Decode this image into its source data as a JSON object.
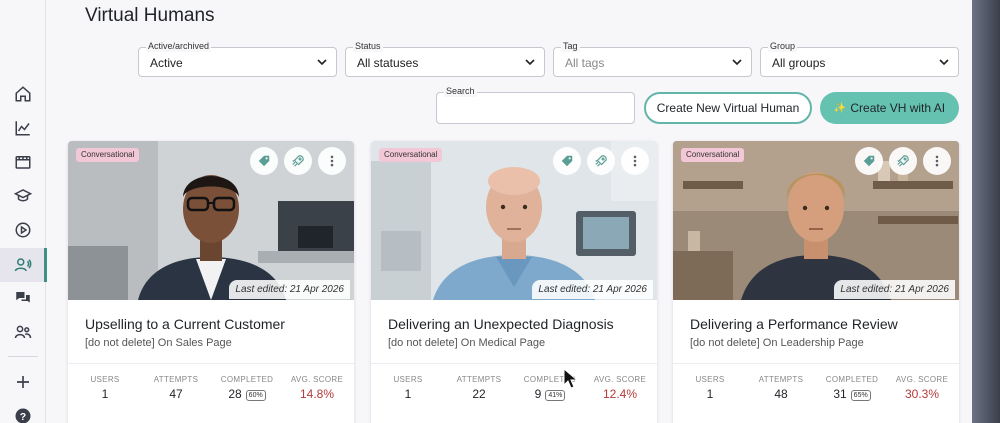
{
  "page": {
    "title": "Virtual Humans"
  },
  "filters": {
    "active": {
      "label": "Active/archived",
      "value": "Active"
    },
    "status": {
      "label": "Status",
      "value": "All statuses"
    },
    "tag": {
      "label": "Tag",
      "placeholder": "All tags"
    },
    "group": {
      "label": "Group",
      "value": "All groups"
    }
  },
  "search": {
    "label": "Search"
  },
  "actions": {
    "create_new": "Create New Virtual Human",
    "create_ai": "Create VH with AI",
    "create_ai_icon": "✨"
  },
  "stat_labels": {
    "users": "USERS",
    "attempts": "ATTEMPTS",
    "completed": "COMPLETED",
    "avg_score": "AVG. SCORE"
  },
  "cards": [
    {
      "badge": "Conversational",
      "edited": "Last edited:  21 Apr 2026",
      "title": "Upselling to a Current Customer",
      "subtitle": "[do not delete] On Sales Page",
      "users": "1",
      "attempts": "47",
      "completed": "28",
      "completed_pct": "60%",
      "avg_score": "14.8%"
    },
    {
      "badge": "Conversational",
      "edited": "Last edited:  21 Apr 2026",
      "title": "Delivering an Unexpected Diagnosis",
      "subtitle": "[do not delete] On Medical Page",
      "users": "1",
      "attempts": "22",
      "completed": "9",
      "completed_pct": "41%",
      "avg_score": "12.4%"
    },
    {
      "badge": "Conversational",
      "edited": "Last edited:  21 Apr 2026",
      "title": "Delivering a Performance Review",
      "subtitle": "[do not delete] On Leadership Page",
      "users": "1",
      "attempts": "48",
      "completed": "31",
      "completed_pct": "65%",
      "avg_score": "30.3%"
    }
  ],
  "colors": {
    "accent": "#62b6a8",
    "badge": "#f2c7d6",
    "score": "#b33a3a"
  },
  "icons": {
    "nav": [
      "home-icon",
      "analytics-icon",
      "film-icon",
      "graduation-cap-icon",
      "play-circle-icon",
      "virtual-human-icon",
      "chat-icon",
      "users-icon",
      "plus-icon",
      "help-icon"
    ]
  }
}
